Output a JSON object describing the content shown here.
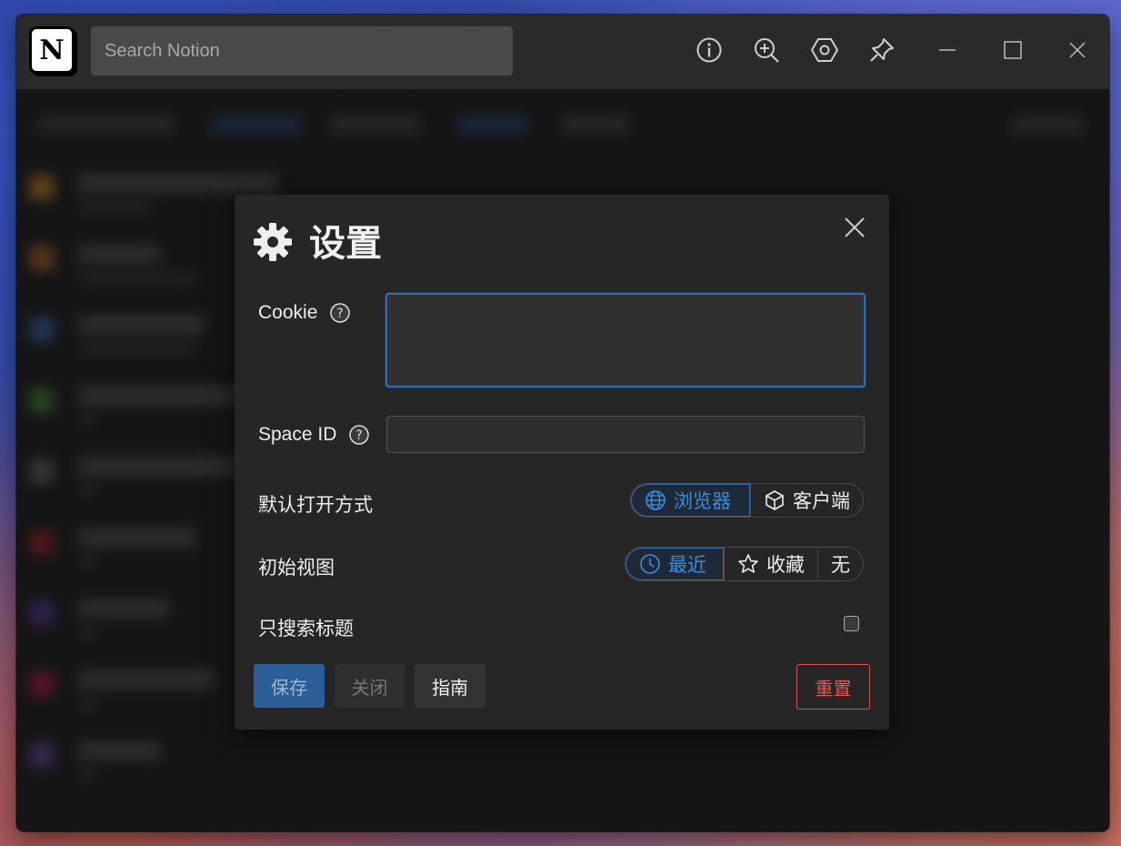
{
  "titlebar": {
    "logo_letter": "N",
    "search_placeholder": "Search Notion",
    "icons": [
      "info-icon",
      "zoom-in-icon",
      "hexagon-settings-icon",
      "pin-icon",
      "minimize-icon",
      "maximize-icon",
      "close-icon"
    ]
  },
  "dialog": {
    "title": "设置",
    "cookie": {
      "label": "Cookie",
      "value": ""
    },
    "space_id": {
      "label": "Space ID",
      "value": ""
    },
    "open_mode": {
      "label": "默认打开方式",
      "options": [
        {
          "label": "浏览器",
          "icon": "globe-icon",
          "selected": true
        },
        {
          "label": "客户端",
          "icon": "cube-icon",
          "selected": false
        }
      ]
    },
    "initial_view": {
      "label": "初始视图",
      "options": [
        {
          "label": "最近",
          "icon": "clock-icon",
          "selected": true
        },
        {
          "label": "收藏",
          "icon": "star-icon",
          "selected": false
        },
        {
          "label": "无",
          "selected": false
        }
      ]
    },
    "title_only": {
      "label": "只搜索标题",
      "checked": false
    },
    "buttons": {
      "save": "保存",
      "close": "关闭",
      "guide": "指南",
      "reset": "重置"
    }
  },
  "colors": {
    "accent": "#3c8ce0",
    "danger": "#e05a56",
    "dialog_bg": "#262626",
    "titlebar_bg": "#2a2a2a"
  }
}
